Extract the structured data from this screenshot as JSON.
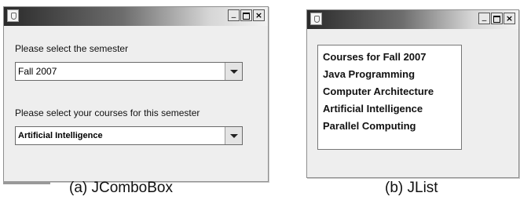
{
  "combo_window": {
    "semester_label": "Please select the semester",
    "semester_value": "Fall 2007",
    "courses_label": "Please select your courses for this semester",
    "courses_value": "Artificial Intelligence"
  },
  "list_window": {
    "items": [
      "Courses for Fall 2007",
      "Java Programming",
      "Computer Architecture",
      "Artificial Intelligence",
      "Parallel Computing"
    ]
  },
  "captions": {
    "left": "(a) JComboBox",
    "right": "(b) JList"
  },
  "icons": {
    "app": "java-cup-icon",
    "minimize": "minimize-icon",
    "maximize": "maximize-icon",
    "close": "close-icon",
    "dropdown": "chevron-down-icon"
  }
}
